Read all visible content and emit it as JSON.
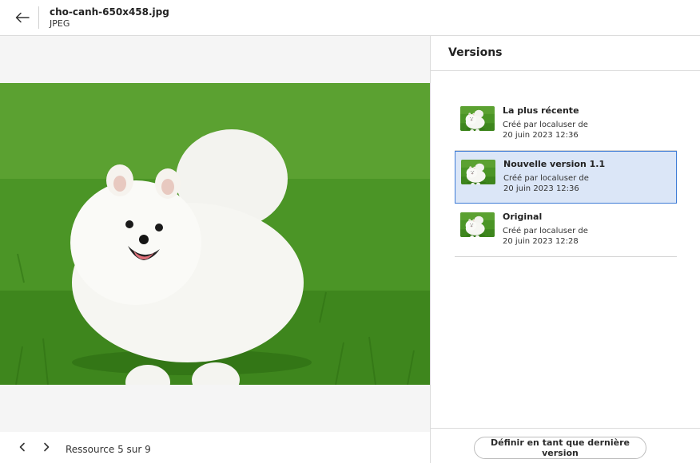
{
  "header": {
    "file_name": "cho-canh-650x458.jpg",
    "file_type": "JPEG"
  },
  "preview": {
    "image_alt": "white pomeranian dog on green grass"
  },
  "footer": {
    "resource_counter": "Ressource 5 sur 9"
  },
  "versions_panel": {
    "title": "Versions",
    "items": [
      {
        "label": "La plus récente",
        "created_by": "Créé par localuser de",
        "date": "20 juin 2023 12:36",
        "selected": false
      },
      {
        "label": "Nouvelle version 1.1",
        "created_by": "Créé par localuser de",
        "date": "20 juin 2023 12:36",
        "selected": true
      },
      {
        "label": "Original",
        "created_by": "Créé par localuser de",
        "date": "20 juin 2023 12:28",
        "selected": false
      }
    ],
    "set_latest_button": "Définir en tant que dernière version"
  },
  "icons": {
    "back": "arrow-left-icon",
    "prev": "chevron-left-icon",
    "next": "chevron-right-icon"
  },
  "colors": {
    "selected_bg": "#dbe6f7",
    "selected_border": "#3d7bd6",
    "grass": "#3f8a1f"
  }
}
